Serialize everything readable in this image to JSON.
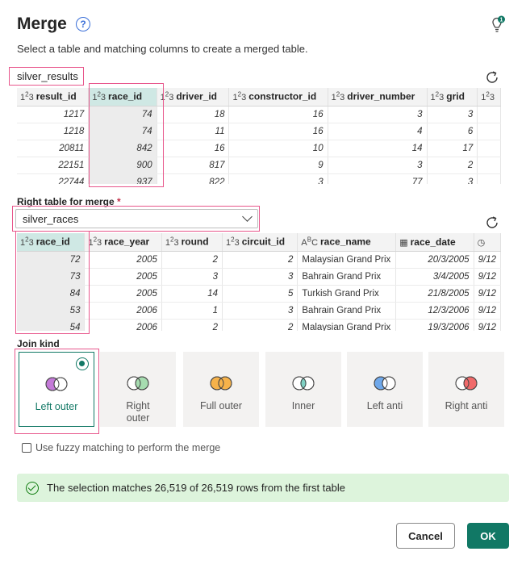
{
  "dialog": {
    "title": "Merge",
    "subtitle": "Select a table and matching columns to create a merged table."
  },
  "left_table": {
    "name": "silver_results",
    "columns": [
      {
        "type": "123",
        "name": "result_id"
      },
      {
        "type": "123",
        "name": "race_id"
      },
      {
        "type": "123",
        "name": "driver_id"
      },
      {
        "type": "123",
        "name": "constructor_id"
      },
      {
        "type": "123",
        "name": "driver_number"
      },
      {
        "type": "123",
        "name": "grid"
      },
      {
        "type": "123",
        "name": ""
      }
    ],
    "rows": [
      [
        "1217",
        "74",
        "18",
        "16",
        "3",
        "3"
      ],
      [
        "1218",
        "74",
        "11",
        "16",
        "4",
        "6"
      ],
      [
        "20811",
        "842",
        "16",
        "10",
        "14",
        "17"
      ],
      [
        "22151",
        "900",
        "817",
        "9",
        "3",
        "2"
      ],
      [
        "22744",
        "937",
        "822",
        "3",
        "77",
        "3"
      ]
    ]
  },
  "right_table": {
    "label": "Right table for merge",
    "required_mark": "*",
    "selected": "silver_races",
    "columns": [
      {
        "type": "123",
        "name": "race_id"
      },
      {
        "type": "123",
        "name": "race_year"
      },
      {
        "type": "123",
        "name": "round"
      },
      {
        "type": "123",
        "name": "circuit_id"
      },
      {
        "type": "ABC",
        "name": "race_name"
      },
      {
        "type": "date",
        "name": "race_date"
      },
      {
        "type": "time",
        "name": ""
      }
    ],
    "rows": [
      [
        "72",
        "2005",
        "2",
        "2",
        "Malaysian Grand Prix",
        "20/3/2005",
        "9/12"
      ],
      [
        "73",
        "2005",
        "3",
        "3",
        "Bahrain Grand Prix",
        "3/4/2005",
        "9/12"
      ],
      [
        "84",
        "2005",
        "14",
        "5",
        "Turkish Grand Prix",
        "21/8/2005",
        "9/12"
      ],
      [
        "53",
        "2006",
        "1",
        "3",
        "Bahrain Grand Prix",
        "12/3/2006",
        "9/12"
      ],
      [
        "54",
        "2006",
        "2",
        "2",
        "Malaysian Grand Prix",
        "19/3/2006",
        "9/12"
      ]
    ]
  },
  "join_kind": {
    "label": "Join kind",
    "options": [
      {
        "label": "Left outer",
        "selected": true
      },
      {
        "label": "Right outer",
        "selected": false
      },
      {
        "label": "Full outer",
        "selected": false
      },
      {
        "label": "Inner",
        "selected": false
      },
      {
        "label": "Left anti",
        "selected": false
      },
      {
        "label": "Right anti",
        "selected": false
      }
    ]
  },
  "fuzzy": {
    "label": "Use fuzzy matching to perform the merge",
    "checked": false
  },
  "status": {
    "text": "The selection matches 26,519 of 26,519 rows from the first table"
  },
  "buttons": {
    "cancel": "Cancel",
    "ok": "OK"
  },
  "colors": {
    "accent": "#117865",
    "highlight": "#e8578c",
    "success_bg": "#ddf4dc"
  }
}
